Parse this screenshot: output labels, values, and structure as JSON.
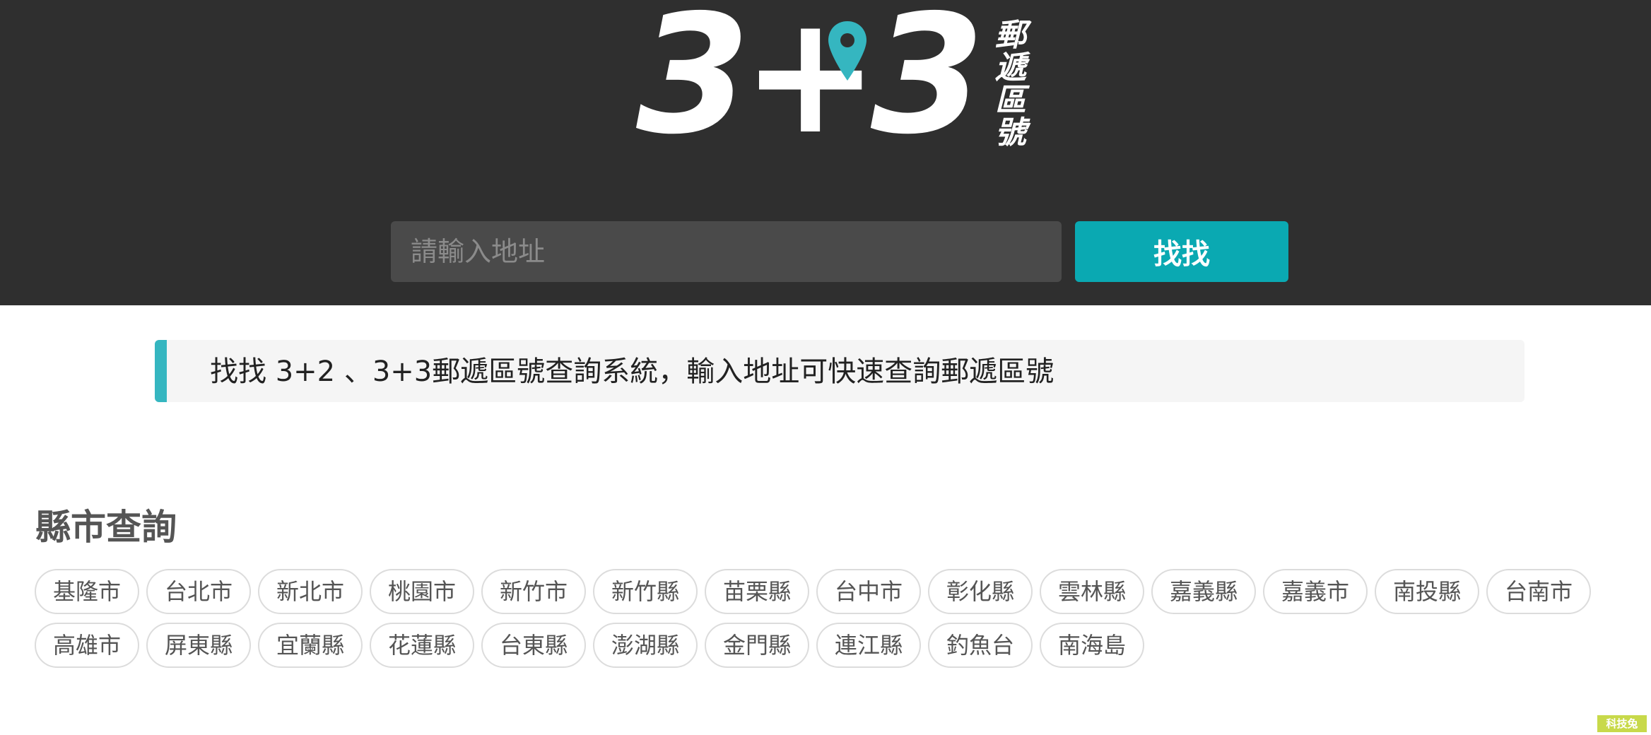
{
  "header": {
    "logo": {
      "main": "3+3",
      "side": "郵遞區號"
    },
    "search": {
      "placeholder": "請輸入地址",
      "button_label": "找找"
    }
  },
  "intro": {
    "text": "找找 3+2 、3+3郵遞區號查詢系統，輸入地址可快速查詢郵遞區號"
  },
  "county_section": {
    "title": "縣市查詢",
    "counties": [
      "基隆市",
      "台北市",
      "新北市",
      "桃園市",
      "新竹市",
      "新竹縣",
      "苗栗縣",
      "台中市",
      "彰化縣",
      "雲林縣",
      "嘉義縣",
      "嘉義市",
      "南投縣",
      "台南市",
      "高雄市",
      "屏東縣",
      "宜蘭縣",
      "花蓮縣",
      "台東縣",
      "澎湖縣",
      "金門縣",
      "連江縣",
      "釣魚台",
      "南海島"
    ]
  },
  "watermark": {
    "text": "科技兔"
  },
  "colors": {
    "header_bg": "#2f2f2f",
    "accent": "#0aa9b2",
    "pin": "#35b6c0"
  }
}
